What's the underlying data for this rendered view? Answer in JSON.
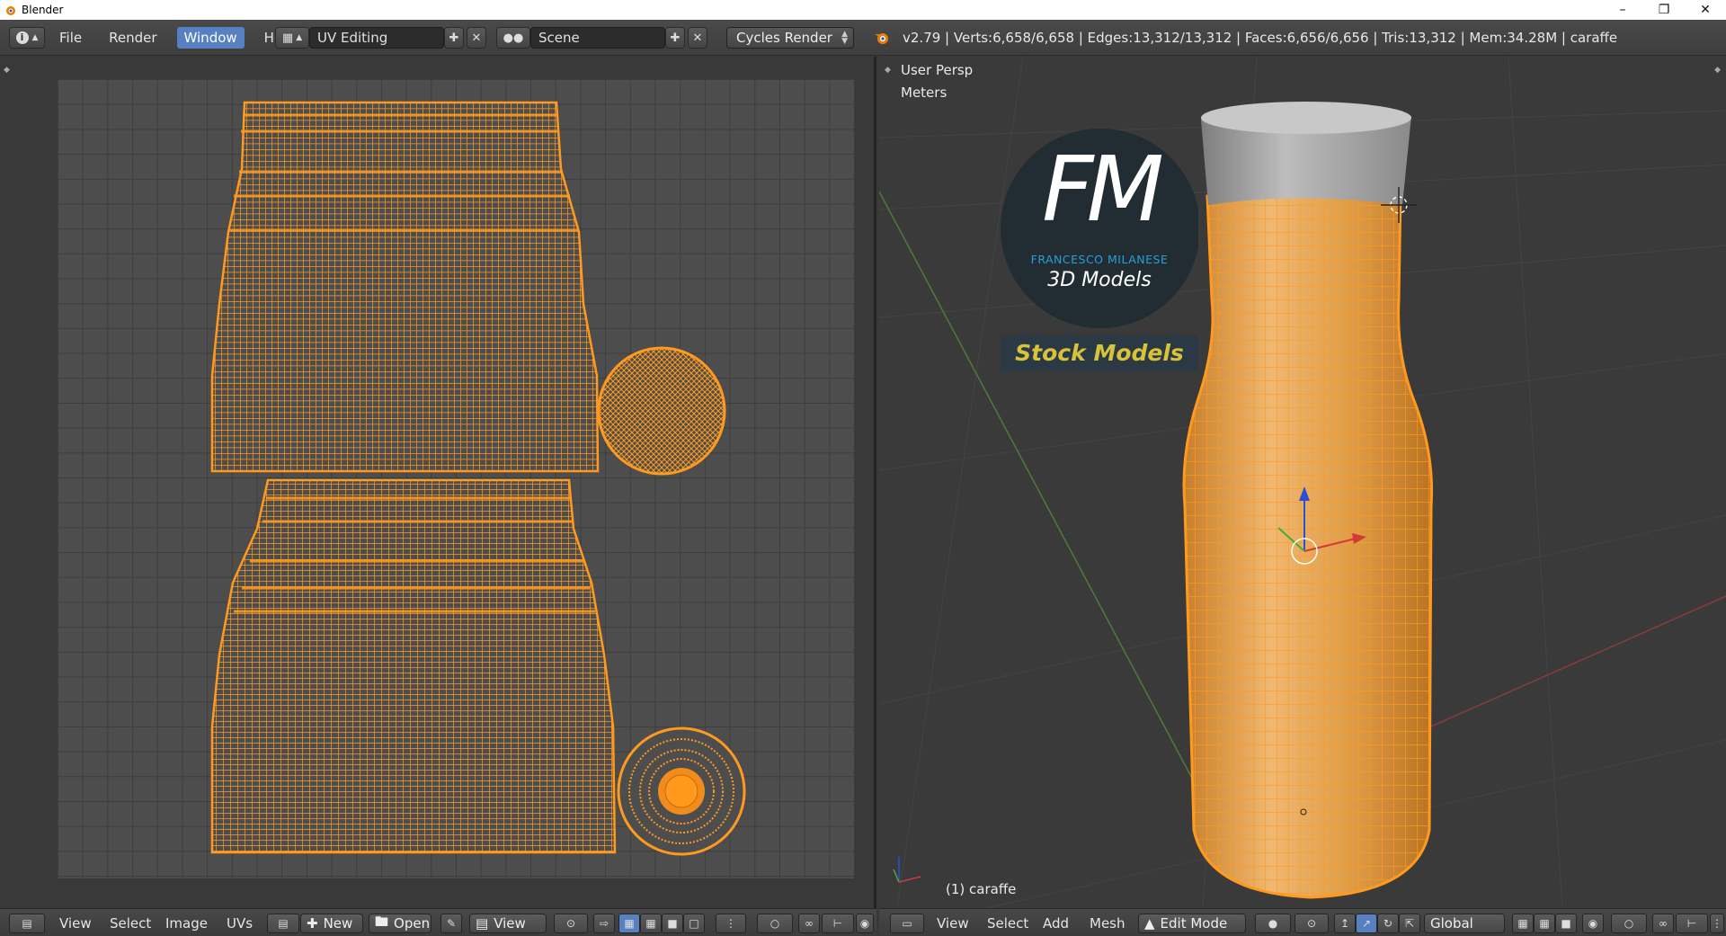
{
  "window": {
    "title": "Blender"
  },
  "menu": {
    "file": "File",
    "render": "Render",
    "window": "Window",
    "help": "Help"
  },
  "screen_layout": "UV Editing",
  "scene": "Scene",
  "render_engine": "Cycles Render",
  "stats": "v2.79 | Verts:6,658/6,658 | Edges:13,312/13,312 | Faces:6,656/6,656 | Tris:13,312 | Mem:34.28M | caraffe",
  "viewport": {
    "view_name": "User Persp",
    "units": "Meters",
    "object_label": "(1) caraffe"
  },
  "logo": {
    "initials": "FM",
    "author": "FRANCESCO MILANESE",
    "subtitle": "3D Models",
    "banner": "Stock Models"
  },
  "uv_header": {
    "view": "View",
    "select": "Select",
    "image": "Image",
    "uvs": "UVs",
    "new": "New",
    "open": "Open",
    "view_menu": "View"
  },
  "view3d_header": {
    "view": "View",
    "select": "Select",
    "add": "Add",
    "mesh": "Mesh",
    "mode": "Edit Mode",
    "orientation": "Global"
  },
  "colors": {
    "mesh_orange": "#ff9a1f",
    "mesh_fill": "#e3a04a",
    "active_blue": "#5680c2",
    "logo_blue": "#2a9fd8",
    "banner_yellow": "#d8c23a"
  }
}
